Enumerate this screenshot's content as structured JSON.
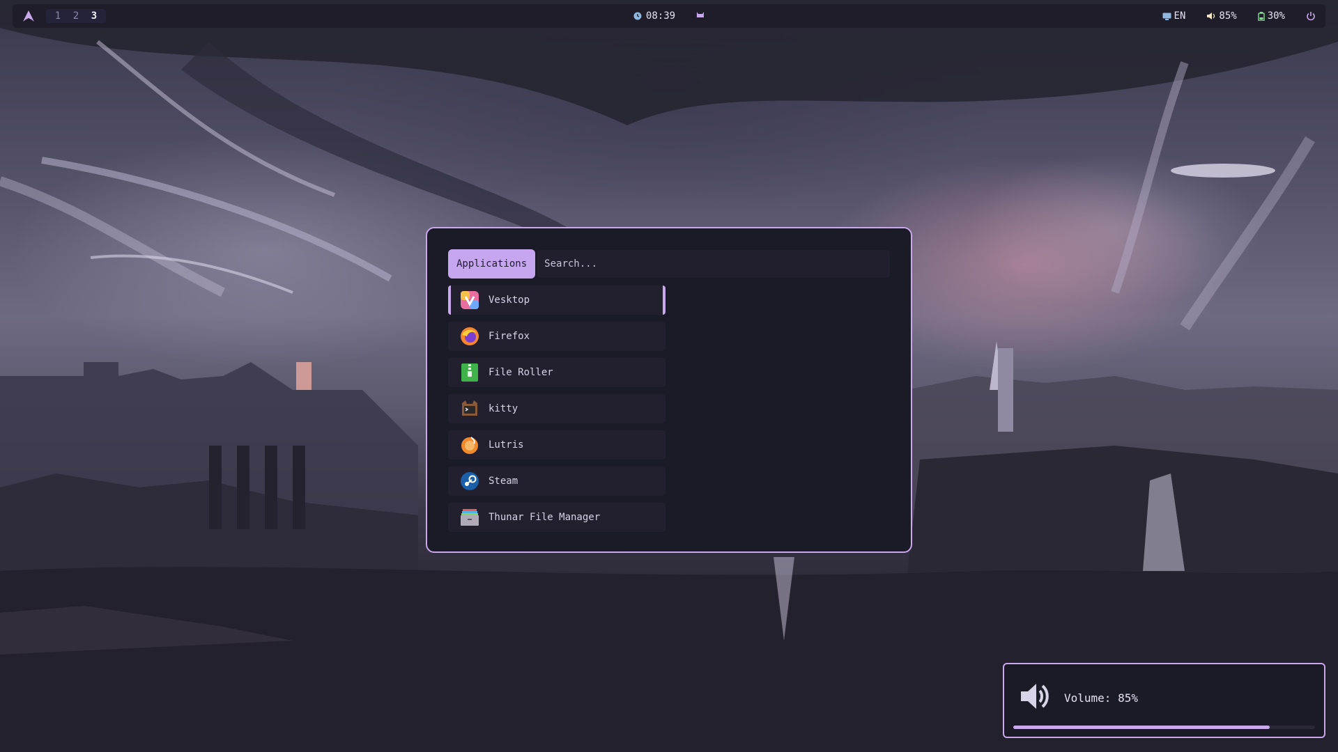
{
  "topbar": {
    "logo_icon": "arch-logo-icon",
    "workspaces": [
      "1",
      "2",
      "3"
    ],
    "active_workspace": "3",
    "clock": "08:39",
    "keyboard_layout": "EN",
    "volume": "85%",
    "battery": "30%"
  },
  "launcher": {
    "mode_label": "Applications",
    "search_placeholder": "Search...",
    "apps": [
      {
        "name": "Vesktop",
        "icon": "vesktop-icon"
      },
      {
        "name": "Firefox",
        "icon": "firefox-icon"
      },
      {
        "name": "File Roller",
        "icon": "archive-icon"
      },
      {
        "name": "kitty",
        "icon": "kitty-icon"
      },
      {
        "name": "Lutris",
        "icon": "lutris-icon"
      },
      {
        "name": "Steam",
        "icon": "steam-icon"
      },
      {
        "name": "Thunar File Manager",
        "icon": "file-manager-icon"
      }
    ],
    "selected_index": 0
  },
  "osd": {
    "label": "Volume: 85%",
    "level": 0.85
  },
  "colors": {
    "accent": "#c9a8ec",
    "panel": "#1b1a27",
    "bar": "#1e1d29"
  }
}
